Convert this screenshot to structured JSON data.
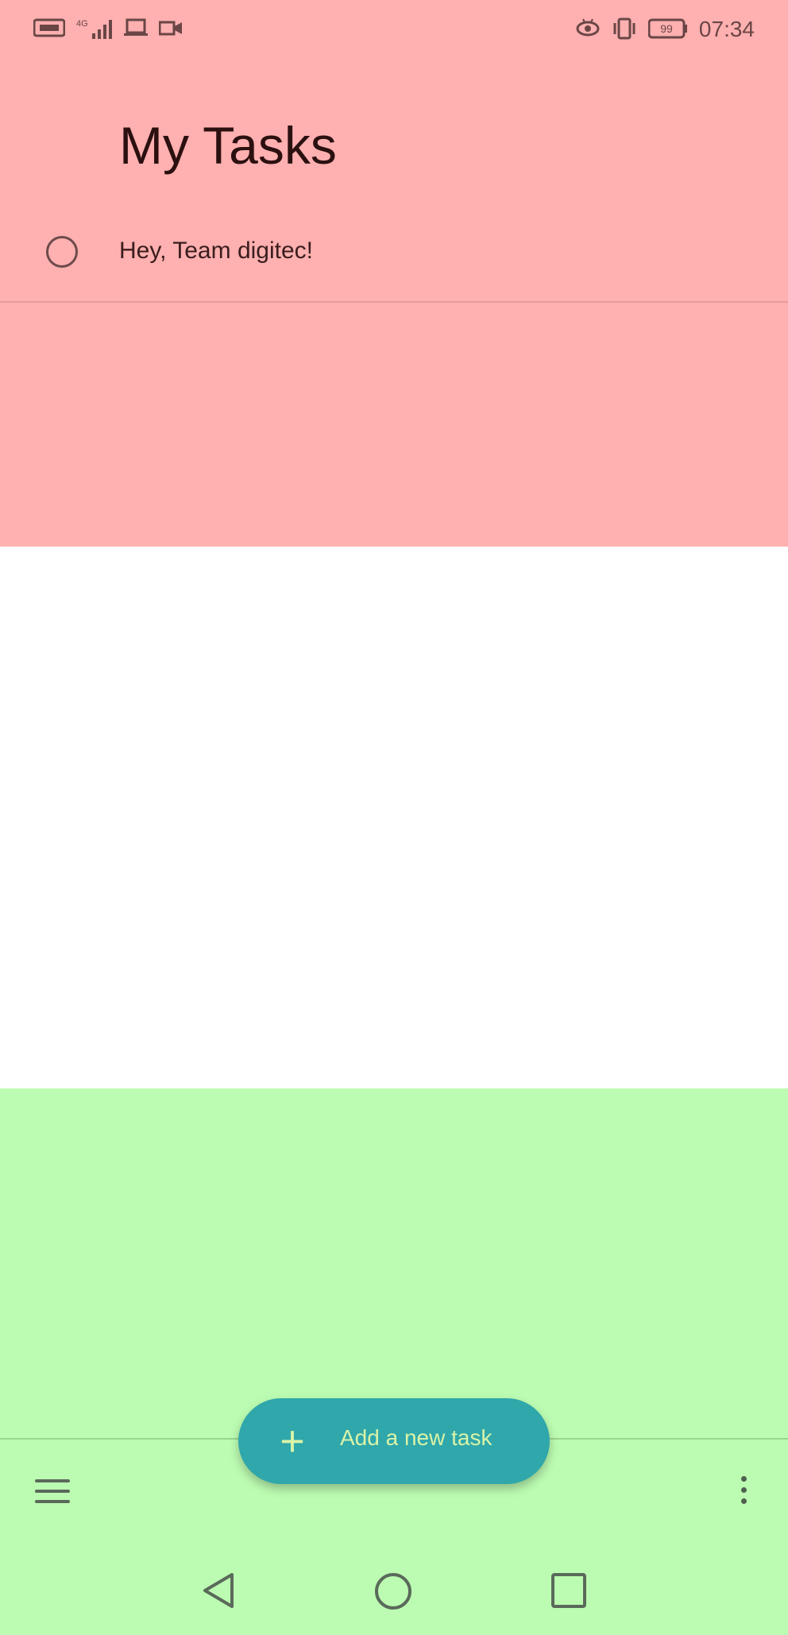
{
  "status_bar": {
    "left_icons": [
      "nfc-icon",
      "signal-4g-icon",
      "laptop-icon",
      "video-icon"
    ],
    "right_icons": [
      "eye-comfort-icon",
      "vibrate-icon",
      "battery-icon"
    ],
    "battery": "99",
    "time": "07:34"
  },
  "header": {
    "title": "My Tasks"
  },
  "tasks": [
    {
      "label": "Hey, Team digitec!"
    }
  ],
  "bottom_bar": {
    "add_button_label": "Add a new task",
    "add_button_icon": "plus-icon",
    "menu_icon": "menu-icon",
    "more_icon": "more-vert-icon"
  },
  "nav_bar": {
    "back_icon": "back-icon",
    "home_icon": "home-icon",
    "recent_icon": "recent-apps-icon"
  },
  "colors": {
    "top_band": "#ffb0b0",
    "bottom_band": "#bcfcb2",
    "fab": "#2fa7ab",
    "fab_text": "#d9f3a8"
  }
}
